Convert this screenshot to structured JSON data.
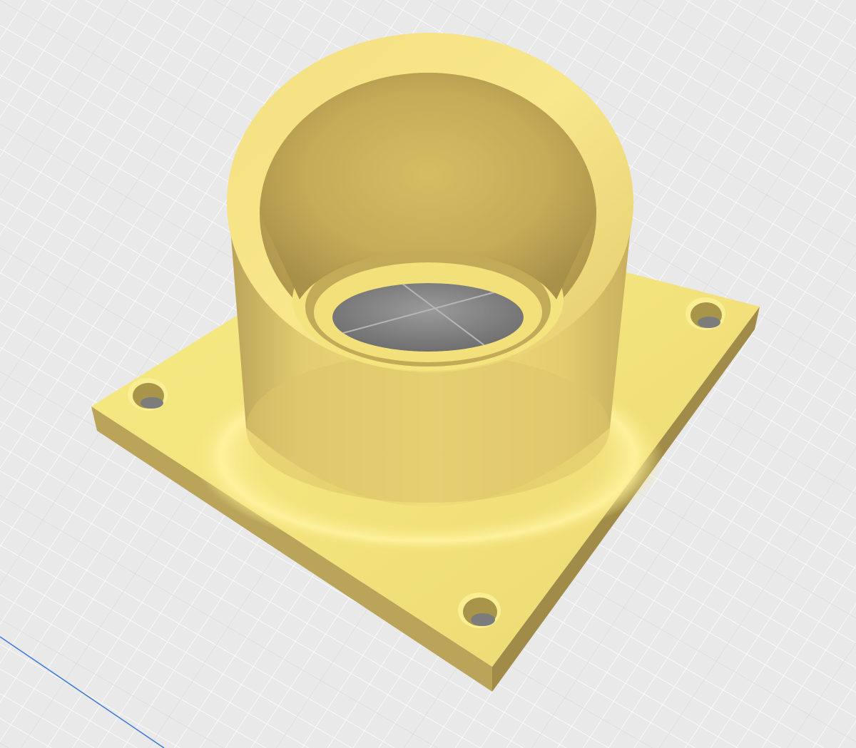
{
  "viewport": {
    "background": "#e9e9e9",
    "grid_minor_color": "#ffffff",
    "grid_major_color": "#cfcfcf",
    "axis_color": "#3a78d8"
  },
  "model": {
    "kind": "flange-tube-adapter",
    "base_color": "#f6e880",
    "tube_color": "#dcc46a",
    "inner_color": "#c7ac5a",
    "shadow_color": "#9f8a47",
    "floor_color": "#8a8a8a",
    "mounting_holes": 4
  }
}
